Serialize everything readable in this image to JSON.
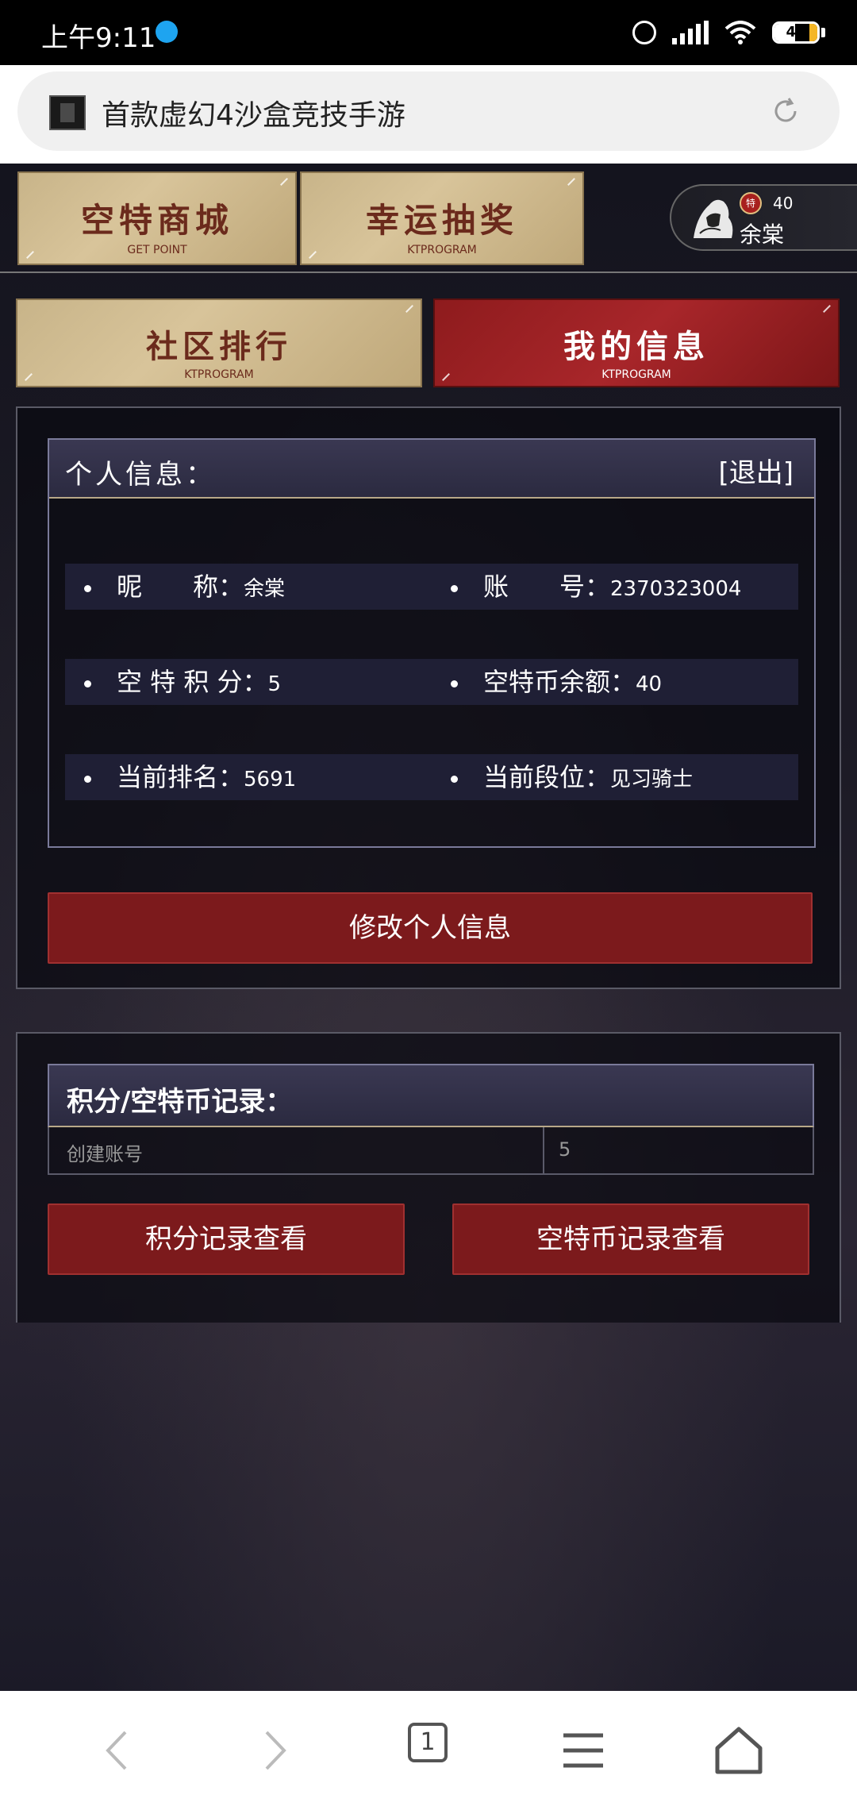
{
  "status_bar": {
    "time": "上午9:11",
    "battery": "48"
  },
  "browser": {
    "page_title": "首款虚幻4沙盒竞技手游",
    "tab_count": "1"
  },
  "top_buttons": [
    {
      "title": "空特商城",
      "subtitle": "GET POINT"
    },
    {
      "title": "幸运抽奖",
      "subtitle": "KTPROGRAM"
    }
  ],
  "user": {
    "coin_icon": "特",
    "coins": "40",
    "name": "余棠"
  },
  "nav_tabs": [
    {
      "title": "社区排行",
      "subtitle": "KTPROGRAM",
      "active": false
    },
    {
      "title": "我的信息",
      "subtitle": "KTPROGRAM",
      "active": true
    }
  ],
  "personal_info": {
    "heading": "个人信息：",
    "logout": "[退出]",
    "fields": [
      {
        "label": "昵　　称：",
        "value": "余棠"
      },
      {
        "label": "账　　号：",
        "value": "2370323004"
      },
      {
        "label": "空 特 积 分：",
        "value": "5"
      },
      {
        "label": "空特币余额：",
        "value": "40"
      },
      {
        "label": "当前排名：",
        "value": "5691"
      },
      {
        "label": "当前段位：",
        "value": "见习骑士"
      }
    ],
    "edit_button": "修改个人信息"
  },
  "records": {
    "heading": "积分/空特币记录：",
    "rows": [
      {
        "desc": "创建账号",
        "amount": "5"
      }
    ],
    "points_button": "积分记录查看",
    "coins_button": "空特币记录查看"
  },
  "colors": {
    "accent_red": "#7c1a1c",
    "gold": "#c8b489",
    "battery_low": "#f5b625"
  },
  "battery_level": 0.48
}
